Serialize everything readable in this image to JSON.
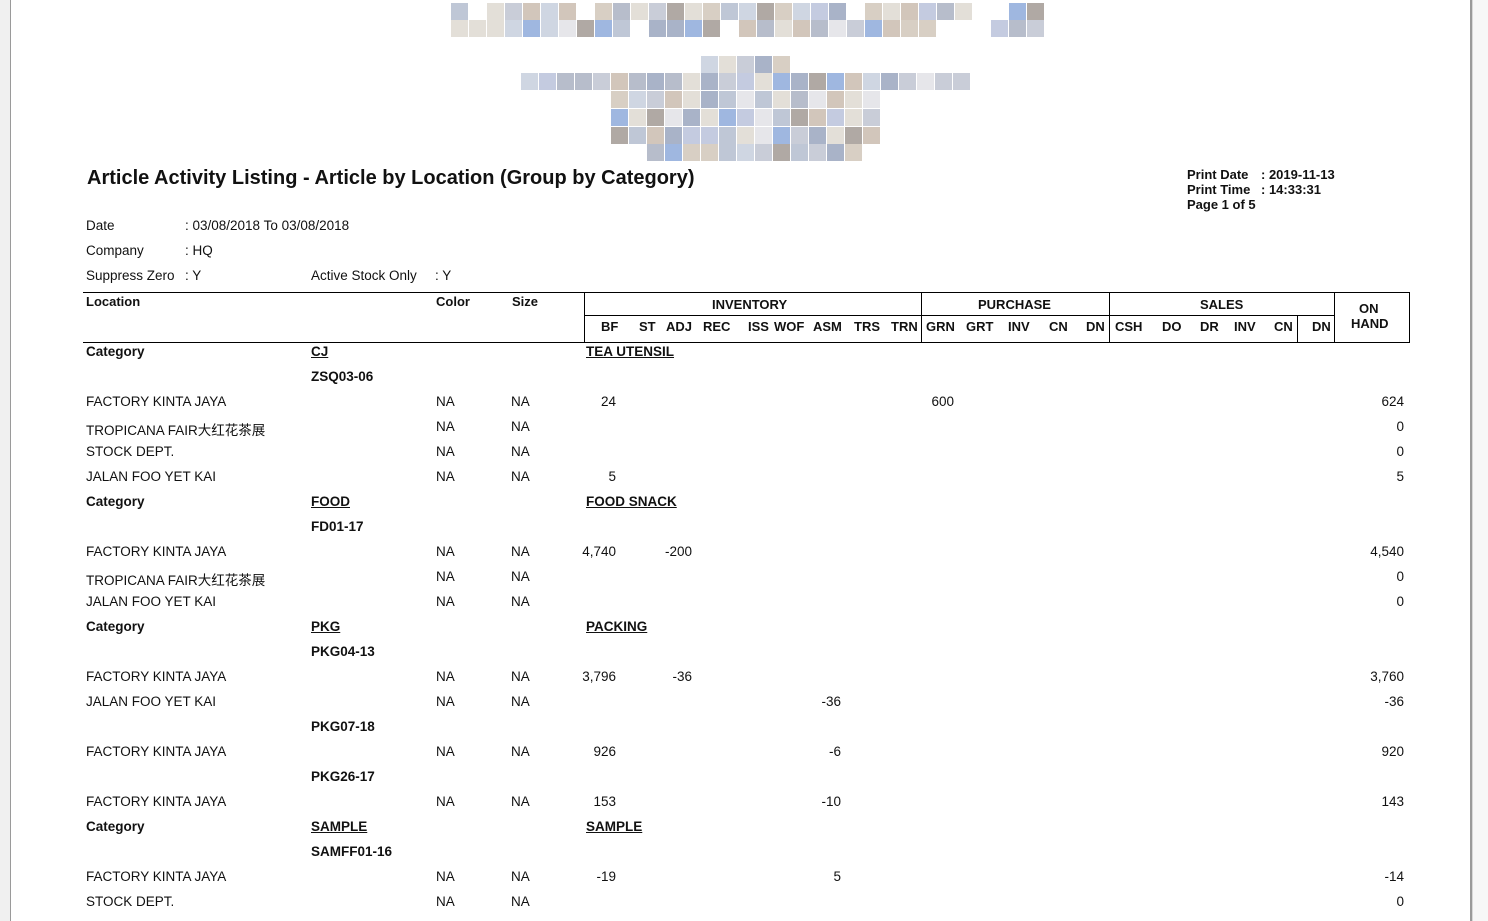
{
  "report": {
    "title": "Article Activity Listing - Article by Location (Group by Category)",
    "print_date_label": "Print Date",
    "print_date_value": ": 2019-11-13",
    "print_time_label": "Print Time",
    "print_time_value": ": 14:33:31",
    "page_label": "Page 1 of 5"
  },
  "filters": {
    "date_label": "Date",
    "date_value": ": 03/08/2018 To 03/08/2018",
    "company_label": "Company",
    "company_value": ": HQ",
    "suppress_label": "Suppress Zero",
    "suppress_value": ": Y",
    "active_label": "Active Stock Only",
    "active_value": ": Y"
  },
  "headers": {
    "location": "Location",
    "color": "Color",
    "size": "Size",
    "inventory": "INVENTORY",
    "purchase": "PURCHASE",
    "sales": "SALES",
    "on": "ON",
    "hand": "HAND",
    "inv_cols": [
      "BF",
      "ST",
      "ADJ",
      "REC",
      "ISS",
      "WOF",
      "ASM",
      "TRS",
      "TRN"
    ],
    "pur_cols": [
      "GRN",
      "GRT",
      "INV",
      "CN",
      "DN"
    ],
    "sal_cols": [
      "CSH",
      "DO",
      "DR",
      "INV",
      "CN",
      "DN"
    ]
  },
  "rows": [
    {
      "type": "category",
      "label": "Category",
      "code": "CJ",
      "name": "TEA UTENSIL"
    },
    {
      "type": "article",
      "code": "ZSQ03-06"
    },
    {
      "type": "data",
      "loc": "FACTORY KINTA JAYA",
      "color": "NA",
      "size": "NA",
      "bf": "24",
      "grn": "600",
      "onhand": "624"
    },
    {
      "type": "data",
      "loc": "TROPICANA FAIR大红花茶展",
      "color": "NA",
      "size": "NA",
      "onhand": "0"
    },
    {
      "type": "data",
      "loc": "STOCK DEPT.",
      "color": "NA",
      "size": "NA",
      "onhand": "0"
    },
    {
      "type": "data",
      "loc": "JALAN FOO YET KAI",
      "color": "NA",
      "size": "NA",
      "bf": "5",
      "onhand": "5"
    },
    {
      "type": "category",
      "label": "Category",
      "code": "FOOD",
      "name": "FOOD SNACK"
    },
    {
      "type": "article",
      "code": "FD01-17"
    },
    {
      "type": "data",
      "loc": "FACTORY KINTA JAYA",
      "color": "NA",
      "size": "NA",
      "bf": "4,740",
      "adj": "-200",
      "onhand": "4,540"
    },
    {
      "type": "data",
      "loc": "TROPICANA FAIR大红花茶展",
      "color": "NA",
      "size": "NA",
      "onhand": "0"
    },
    {
      "type": "data",
      "loc": "JALAN FOO YET KAI",
      "color": "NA",
      "size": "NA",
      "onhand": "0"
    },
    {
      "type": "category",
      "label": "Category",
      "code": "PKG",
      "name": "PACKING"
    },
    {
      "type": "article",
      "code": "PKG04-13"
    },
    {
      "type": "data",
      "loc": "FACTORY KINTA JAYA",
      "color": "NA",
      "size": "NA",
      "bf": "3,796",
      "adj": "-36",
      "onhand": "3,760"
    },
    {
      "type": "data",
      "loc": "JALAN FOO YET KAI",
      "color": "NA",
      "size": "NA",
      "asm": "-36",
      "onhand": "-36"
    },
    {
      "type": "article",
      "code": "PKG07-18"
    },
    {
      "type": "data",
      "loc": "FACTORY KINTA JAYA",
      "color": "NA",
      "size": "NA",
      "bf": "926",
      "asm": "-6",
      "onhand": "920"
    },
    {
      "type": "article",
      "code": "PKG26-17"
    },
    {
      "type": "data",
      "loc": "FACTORY KINTA JAYA",
      "color": "NA",
      "size": "NA",
      "bf": "153",
      "asm": "-10",
      "onhand": "143"
    },
    {
      "type": "category",
      "label": "Category",
      "code": "SAMPLE",
      "name": "SAMPLE"
    },
    {
      "type": "article",
      "code": "SAMFF01-16"
    },
    {
      "type": "data",
      "loc": "FACTORY KINTA JAYA",
      "color": "NA",
      "size": "NA",
      "bf": "-19",
      "asm": "5",
      "onhand": "-14"
    },
    {
      "type": "data",
      "loc": "STOCK DEPT.",
      "color": "NA",
      "size": "NA",
      "onhand": "0"
    }
  ],
  "colors": {
    "page_bg": "#ffffff",
    "frame": "#9a9a9a",
    "text": "#111111"
  }
}
